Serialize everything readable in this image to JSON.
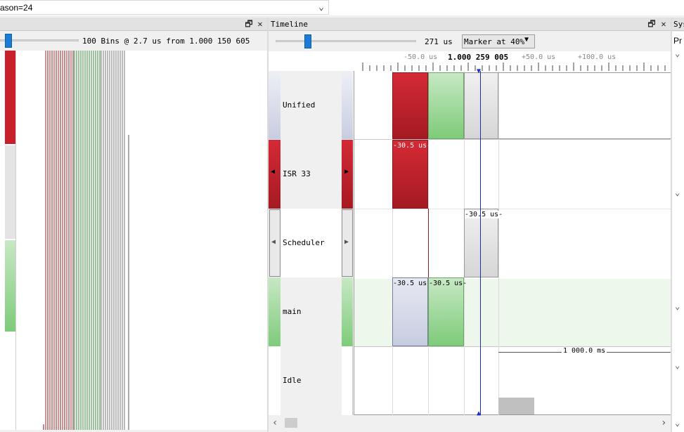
{
  "filter": {
    "value": "ason=24"
  },
  "left_pane": {
    "histogram_label": "100 Bins @ 2.7 us from 1.000 150 605"
  },
  "timeline": {
    "title": "Timeline",
    "window_value": "271 us",
    "marker_value": "Marker at 40%",
    "ruler": {
      "labels": [
        "-50.0 us",
        "1.000 259 005",
        "+50.0 us",
        "+100.0 us"
      ]
    },
    "rows": [
      {
        "label": "Unified"
      },
      {
        "label": "ISR 33"
      },
      {
        "label": "Scheduler"
      },
      {
        "label": "main"
      },
      {
        "label": "Idle"
      }
    ],
    "annotations": {
      "isr_duration": "-30.5 us-",
      "scheduler_duration": "-30.5 us-",
      "main_duration_1": "-30.5 us-",
      "main_duration_2": "-30.5 us-",
      "idle_duration": "1 000.0 ms"
    }
  },
  "right_pane": {
    "title": "Sys",
    "subtitle": "Pr"
  },
  "colors": {
    "isr": "#c8202b",
    "main": "#7ecb7a",
    "scheduler": "#d8d8d8",
    "unified_left": "#c8cce0",
    "marker": "#1a2dbb"
  }
}
